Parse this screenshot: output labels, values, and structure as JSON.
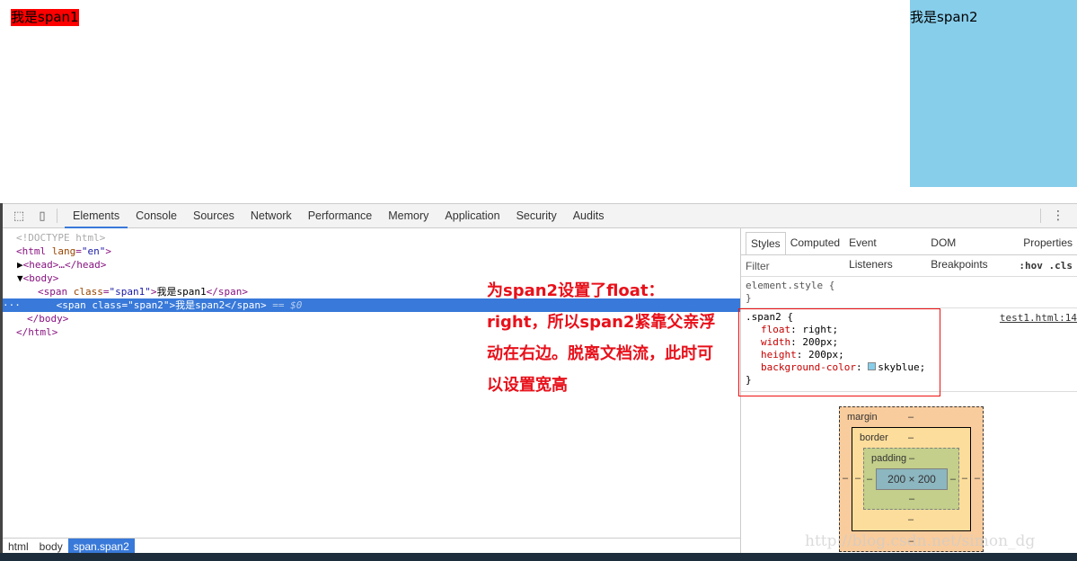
{
  "page": {
    "span1": "我是span1",
    "span2": "我是span2",
    "span2_color": "#87ceeb",
    "span1_color": "#ff0000"
  },
  "toolbar": {
    "tabs": [
      "Elements",
      "Console",
      "Sources",
      "Network",
      "Performance",
      "Memory",
      "Application",
      "Security",
      "Audits"
    ],
    "active": "Elements"
  },
  "dom": {
    "doctype": "<!DOCTYPE html>",
    "html_open": "<html ",
    "lang_attr": "lang",
    "lang_val": "\"en\"",
    "head": "<head>…</head>",
    "body_open": "<body>",
    "span1_text": "我是span1",
    "span2_text": "我是span2",
    "class_attr": "class",
    "span1_class": "\"span1\"",
    "span2_class": "\"span2\"",
    "span_close": "</span>",
    "sel_marker": "== $0",
    "body_close": "</body>",
    "html_close": "</html>"
  },
  "breadcrumbs": [
    "html",
    "body",
    "span.span2"
  ],
  "annotation": "为span2设置了float：right，所以span2紧靠父亲浮动在右边。脱离文档流，此时可以设置宽高",
  "styles": {
    "tabs": [
      "Styles",
      "Computed",
      "Event Listeners",
      "DOM Breakpoints",
      "Properties"
    ],
    "filter_placeholder": "Filter",
    "filter_actions": ":hov  .cls",
    "element_style": "element.style {",
    "close": "}",
    "selector": ".span2 {",
    "source": "test1.html:14",
    "props": [
      {
        "name": "float",
        "value": "right;"
      },
      {
        "name": "width",
        "value": "200px;"
      },
      {
        "name": "height",
        "value": "200px;"
      },
      {
        "name": "background-color",
        "value": "skyblue;"
      }
    ]
  },
  "boxmodel": {
    "margin": "margin",
    "border": "border",
    "padding": "padding",
    "content": "200 × 200",
    "dash": "–"
  },
  "watermark": "http://blog.csdn.net/simon_dg"
}
